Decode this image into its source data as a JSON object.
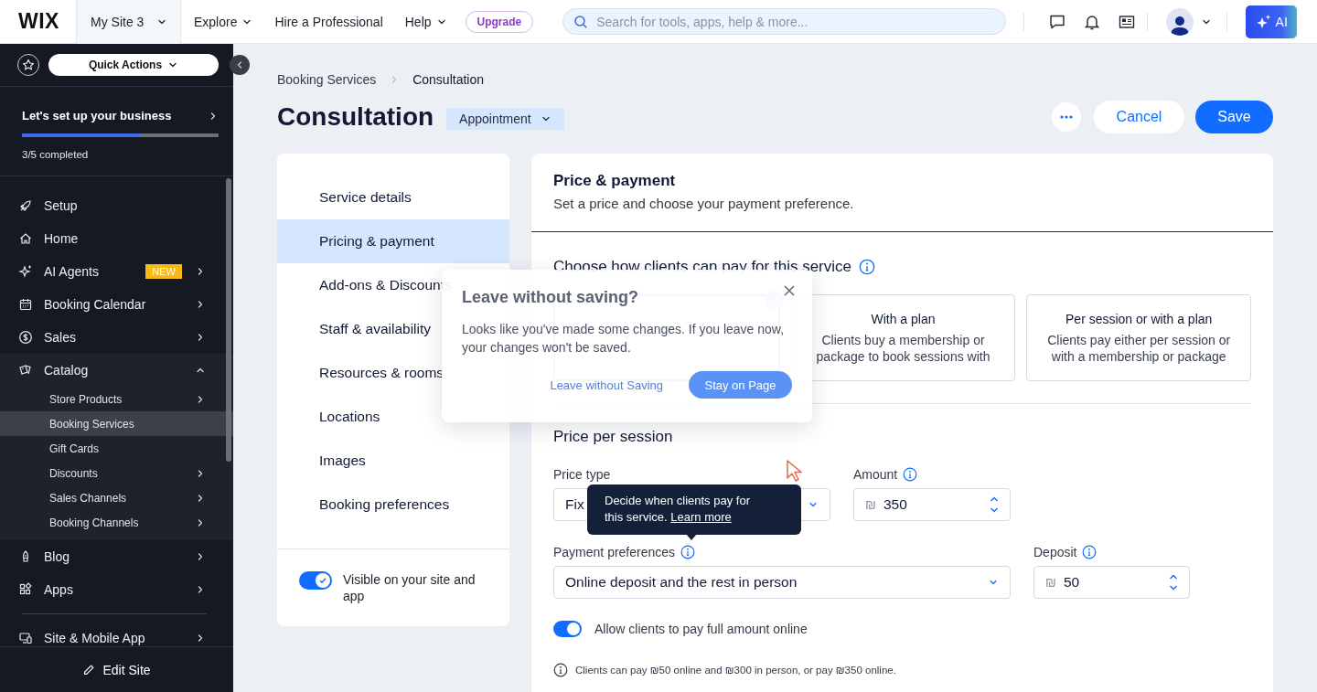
{
  "topbar": {
    "logo": "WIX",
    "site_menu": "My Site 3",
    "nav": [
      {
        "label": "Explore",
        "caret": true
      },
      {
        "label": "Hire a Professional",
        "caret": false
      },
      {
        "label": "Help",
        "caret": true
      }
    ],
    "upgrade": "Upgrade",
    "search": {
      "placeholder": "Search for tools, apps, help & more..."
    },
    "ai_button": "AI"
  },
  "sidebar": {
    "quick_actions": "Quick Actions",
    "setup": {
      "title": "Let's set up your business",
      "level": 0.6,
      "progress_text": "3/5 completed"
    },
    "items": [
      {
        "label": "Setup",
        "chevron": false
      },
      {
        "label": "Home",
        "chevron": false
      },
      {
        "label": "AI Agents",
        "badge": "NEW",
        "chevron": true,
        "expanded": false
      },
      {
        "label": "Booking Calendar",
        "chevron": true,
        "expanded": false
      },
      {
        "label": "Sales",
        "chevron": true,
        "expanded": false
      },
      {
        "label": "Catalog",
        "chevron": true,
        "expanded": true,
        "children": [
          {
            "label": "Store Products",
            "selected": false,
            "chevron": true
          },
          {
            "label": "Booking Services",
            "selected": true,
            "chevron": false
          },
          {
            "label": "Gift Cards",
            "selected": false,
            "chevron": false
          },
          {
            "label": "Discounts",
            "selected": false,
            "chevron": true
          },
          {
            "label": "Sales Channels",
            "selected": false,
            "chevron": true
          },
          {
            "label": "Booking Channels",
            "selected": false,
            "chevron": true
          }
        ]
      },
      {
        "label": "Blog",
        "chevron": true,
        "expanded": false
      },
      {
        "label": "Apps",
        "chevron": true,
        "expanded": false
      },
      {
        "label": "Site & Mobile App",
        "chevron": true,
        "expanded": false
      }
    ],
    "edit_site": "Edit Site"
  },
  "page": {
    "breadcrumb": [
      "Booking Services",
      "Consultation"
    ],
    "title": "Consultation",
    "type_selector": "Appointment",
    "cancel": "Cancel",
    "save": "Save"
  },
  "sections": {
    "items": [
      {
        "label": "Service details",
        "selected": false
      },
      {
        "label": "Pricing & payment",
        "selected": true
      },
      {
        "label": "Add-ons & Discounts",
        "selected": false
      },
      {
        "label": "Staff & availability",
        "selected": false
      },
      {
        "label": "Resources & rooms",
        "selected": false
      },
      {
        "label": "Locations",
        "selected": false
      },
      {
        "label": "Images",
        "selected": false
      },
      {
        "label": "Booking preferences",
        "selected": false
      }
    ],
    "visibility": {
      "label": "Visible on your site and app",
      "on": true
    }
  },
  "pricing": {
    "title": "Price & payment",
    "subtitle": "Set a price and choose your payment preference.",
    "choose_heading": "Choose how clients can pay for this service",
    "options": [
      {
        "selected": true
      },
      {
        "title": "With a plan",
        "description": "Clients buy a membership or package to book sessions with",
        "selected": false
      },
      {
        "title": "Per session or with a plan",
        "description": "Clients pay either per session or with a membership or package",
        "selected": false
      }
    ],
    "session_heading": "Price per session",
    "price_type": {
      "label": "Price type",
      "value": "Fix"
    },
    "amount": {
      "label": "Amount",
      "currency": "₪",
      "value": "350"
    },
    "payment_preferences": {
      "label": "Payment preferences",
      "value": "Online deposit and the rest in person"
    },
    "deposit": {
      "label": "Deposit",
      "currency": "₪",
      "value": "50"
    },
    "full_amount": {
      "label": "Allow clients to pay full amount online",
      "on": true
    },
    "note": "Clients can pay ₪50 online and ₪300 in person, or pay ₪350 online."
  },
  "dialog": {
    "title": "Leave without saving?",
    "body": "Looks like you've made some changes. If you leave now, your changes won't be saved.",
    "secondary": "Leave without Saving",
    "primary": "Stay on Page"
  },
  "tooltip": {
    "text": "Decide when clients pay for this service.",
    "link": "Learn more"
  }
}
